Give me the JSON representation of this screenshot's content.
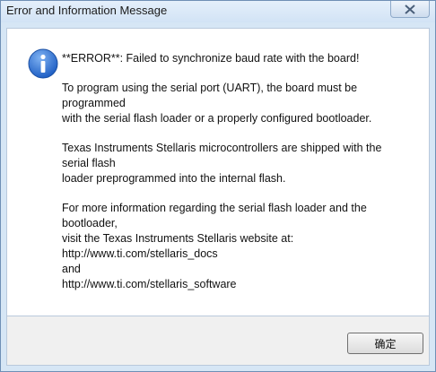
{
  "window": {
    "title": "Error and Information Message"
  },
  "message": {
    "icon": "info-icon",
    "paragraphs": [
      "**ERROR**: Failed to synchronize baud rate with the board!",
      "To program using the serial port (UART), the board must be\nprogrammed\nwith the serial flash loader or a properly configured bootloader.",
      "Texas Instruments Stellaris microcontrollers are shipped with the\nserial flash\nloader preprogrammed into the internal flash.",
      "For more information regarding the serial flash loader and the\nbootloader,\nvisit the Texas Instruments Stellaris website at:\nhttp://www.ti.com/stellaris_docs\nand\nhttp://www.ti.com/stellaris_software"
    ]
  },
  "buttons": {
    "ok_label": "确定"
  },
  "colors": {
    "icon_blue": "#1f5fc4",
    "frame": "#d6e6f5"
  }
}
